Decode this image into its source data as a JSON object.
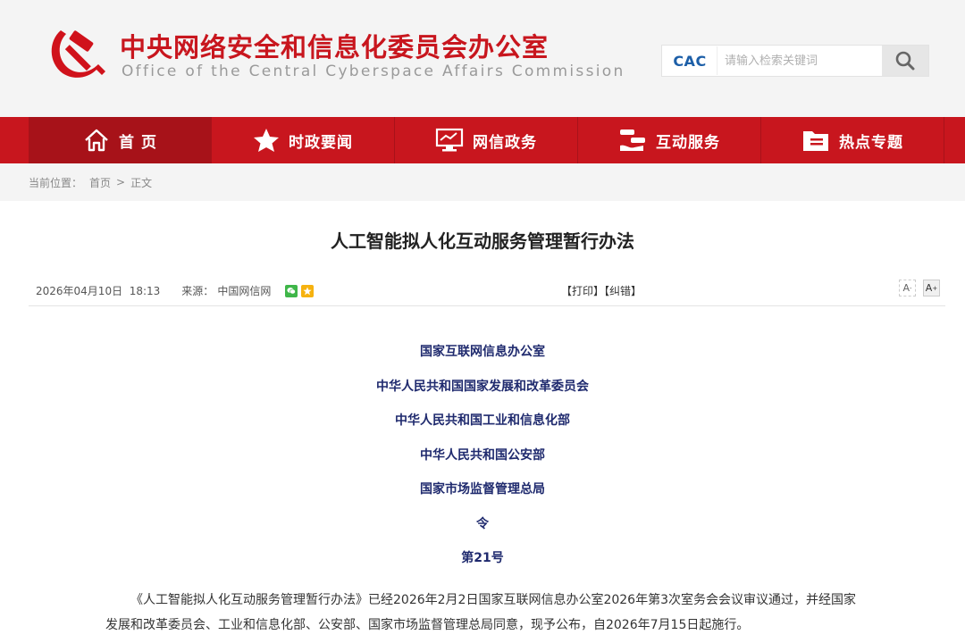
{
  "header": {
    "title_cn": "中央网络安全和信息化委员会办公室",
    "title_en": "Office of the Central Cyberspace Affairs Commission",
    "search": {
      "logo_text": "CAC",
      "placeholder": "请输入检索关键词"
    }
  },
  "nav": {
    "items": [
      {
        "label": "首 页",
        "icon": "home-icon",
        "active": true
      },
      {
        "label": "时政要闻",
        "icon": "star-icon"
      },
      {
        "label": "网信政务",
        "icon": "monitor-icon"
      },
      {
        "label": "互动服务",
        "icon": "interaction-icon"
      },
      {
        "label": "热点专题",
        "icon": "folder-icon"
      }
    ]
  },
  "breadcrumb": {
    "prefix": "当前位置：",
    "home": "首页",
    "sep": ">",
    "current": "正文"
  },
  "article": {
    "title": "人工智能拟人化互动服务管理暂行办法",
    "date": "2026年04月10日  18:13",
    "source_label": "来源：",
    "source": "中国网信网",
    "print": "【打印】",
    "correct": "【纠错】",
    "font_small": "A",
    "font_large": "A",
    "issuers": [
      "国家互联网信息办公室",
      "中华人民共和国国家发展和改革委员会",
      "中华人民共和国工业和信息化部",
      "中华人民共和国公安部",
      "国家市场监督管理总局",
      "令"
    ],
    "order_no": "第21号",
    "body": "《人工智能拟人化互动服务管理暂行办法》已经2026年2月2日国家互联网信息办公室2026年第3次室务会会议审议通过，并经国家发展和改革委员会、工业和信息化部、公安部、国家市场监督管理总局同意，现予公布，自2026年7月15日起施行。"
  },
  "colors": {
    "brand_red": "#c8161e",
    "issuer_blue": "#1f2a6e"
  }
}
